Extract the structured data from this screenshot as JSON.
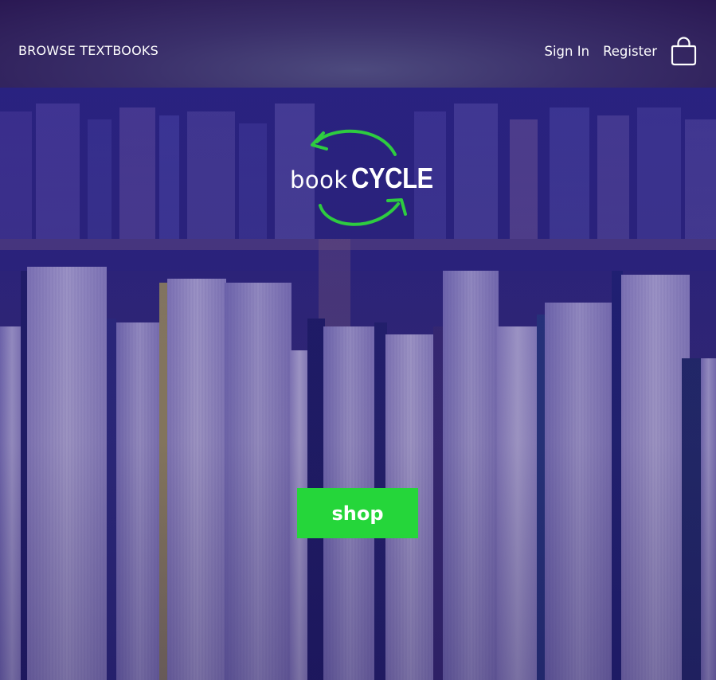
{
  "header": {
    "browse_label": "BROWSE TEXTBOOKS",
    "sign_in_label": "Sign In",
    "register_label": "Register",
    "cart_icon": "shopping-bag-icon"
  },
  "hero": {
    "logo": {
      "book": "book",
      "cycle": "CYCLE",
      "accent_color": "#2ecc40"
    },
    "shop_label": "shop",
    "shop_color": "#25d63a"
  }
}
